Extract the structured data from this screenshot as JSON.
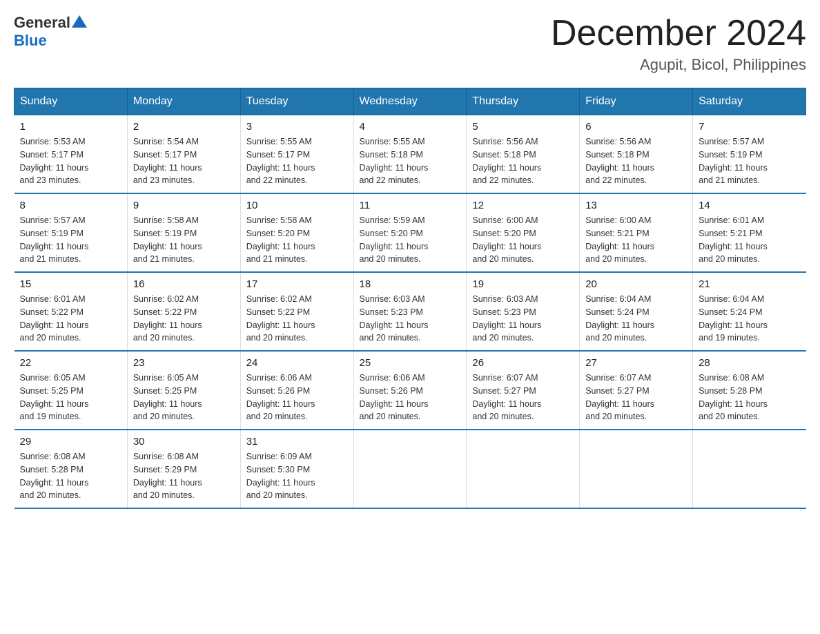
{
  "header": {
    "logo_general": "General",
    "logo_blue": "Blue",
    "title": "December 2024",
    "subtitle": "Agupit, Bicol, Philippines"
  },
  "weekdays": [
    "Sunday",
    "Monday",
    "Tuesday",
    "Wednesday",
    "Thursday",
    "Friday",
    "Saturday"
  ],
  "weeks": [
    [
      {
        "day": "1",
        "sunrise": "5:53 AM",
        "sunset": "5:17 PM",
        "daylight": "11 hours and 23 minutes."
      },
      {
        "day": "2",
        "sunrise": "5:54 AM",
        "sunset": "5:17 PM",
        "daylight": "11 hours and 23 minutes."
      },
      {
        "day": "3",
        "sunrise": "5:55 AM",
        "sunset": "5:17 PM",
        "daylight": "11 hours and 22 minutes."
      },
      {
        "day": "4",
        "sunrise": "5:55 AM",
        "sunset": "5:18 PM",
        "daylight": "11 hours and 22 minutes."
      },
      {
        "day": "5",
        "sunrise": "5:56 AM",
        "sunset": "5:18 PM",
        "daylight": "11 hours and 22 minutes."
      },
      {
        "day": "6",
        "sunrise": "5:56 AM",
        "sunset": "5:18 PM",
        "daylight": "11 hours and 22 minutes."
      },
      {
        "day": "7",
        "sunrise": "5:57 AM",
        "sunset": "5:19 PM",
        "daylight": "11 hours and 21 minutes."
      }
    ],
    [
      {
        "day": "8",
        "sunrise": "5:57 AM",
        "sunset": "5:19 PM",
        "daylight": "11 hours and 21 minutes."
      },
      {
        "day": "9",
        "sunrise": "5:58 AM",
        "sunset": "5:19 PM",
        "daylight": "11 hours and 21 minutes."
      },
      {
        "day": "10",
        "sunrise": "5:58 AM",
        "sunset": "5:20 PM",
        "daylight": "11 hours and 21 minutes."
      },
      {
        "day": "11",
        "sunrise": "5:59 AM",
        "sunset": "5:20 PM",
        "daylight": "11 hours and 20 minutes."
      },
      {
        "day": "12",
        "sunrise": "6:00 AM",
        "sunset": "5:20 PM",
        "daylight": "11 hours and 20 minutes."
      },
      {
        "day": "13",
        "sunrise": "6:00 AM",
        "sunset": "5:21 PM",
        "daylight": "11 hours and 20 minutes."
      },
      {
        "day": "14",
        "sunrise": "6:01 AM",
        "sunset": "5:21 PM",
        "daylight": "11 hours and 20 minutes."
      }
    ],
    [
      {
        "day": "15",
        "sunrise": "6:01 AM",
        "sunset": "5:22 PM",
        "daylight": "11 hours and 20 minutes."
      },
      {
        "day": "16",
        "sunrise": "6:02 AM",
        "sunset": "5:22 PM",
        "daylight": "11 hours and 20 minutes."
      },
      {
        "day": "17",
        "sunrise": "6:02 AM",
        "sunset": "5:22 PM",
        "daylight": "11 hours and 20 minutes."
      },
      {
        "day": "18",
        "sunrise": "6:03 AM",
        "sunset": "5:23 PM",
        "daylight": "11 hours and 20 minutes."
      },
      {
        "day": "19",
        "sunrise": "6:03 AM",
        "sunset": "5:23 PM",
        "daylight": "11 hours and 20 minutes."
      },
      {
        "day": "20",
        "sunrise": "6:04 AM",
        "sunset": "5:24 PM",
        "daylight": "11 hours and 20 minutes."
      },
      {
        "day": "21",
        "sunrise": "6:04 AM",
        "sunset": "5:24 PM",
        "daylight": "11 hours and 19 minutes."
      }
    ],
    [
      {
        "day": "22",
        "sunrise": "6:05 AM",
        "sunset": "5:25 PM",
        "daylight": "11 hours and 19 minutes."
      },
      {
        "day": "23",
        "sunrise": "6:05 AM",
        "sunset": "5:25 PM",
        "daylight": "11 hours and 20 minutes."
      },
      {
        "day": "24",
        "sunrise": "6:06 AM",
        "sunset": "5:26 PM",
        "daylight": "11 hours and 20 minutes."
      },
      {
        "day": "25",
        "sunrise": "6:06 AM",
        "sunset": "5:26 PM",
        "daylight": "11 hours and 20 minutes."
      },
      {
        "day": "26",
        "sunrise": "6:07 AM",
        "sunset": "5:27 PM",
        "daylight": "11 hours and 20 minutes."
      },
      {
        "day": "27",
        "sunrise": "6:07 AM",
        "sunset": "5:27 PM",
        "daylight": "11 hours and 20 minutes."
      },
      {
        "day": "28",
        "sunrise": "6:08 AM",
        "sunset": "5:28 PM",
        "daylight": "11 hours and 20 minutes."
      }
    ],
    [
      {
        "day": "29",
        "sunrise": "6:08 AM",
        "sunset": "5:28 PM",
        "daylight": "11 hours and 20 minutes."
      },
      {
        "day": "30",
        "sunrise": "6:08 AM",
        "sunset": "5:29 PM",
        "daylight": "11 hours and 20 minutes."
      },
      {
        "day": "31",
        "sunrise": "6:09 AM",
        "sunset": "5:30 PM",
        "daylight": "11 hours and 20 minutes."
      },
      null,
      null,
      null,
      null
    ]
  ],
  "labels": {
    "sunrise": "Sunrise:",
    "sunset": "Sunset:",
    "daylight": "Daylight:"
  }
}
